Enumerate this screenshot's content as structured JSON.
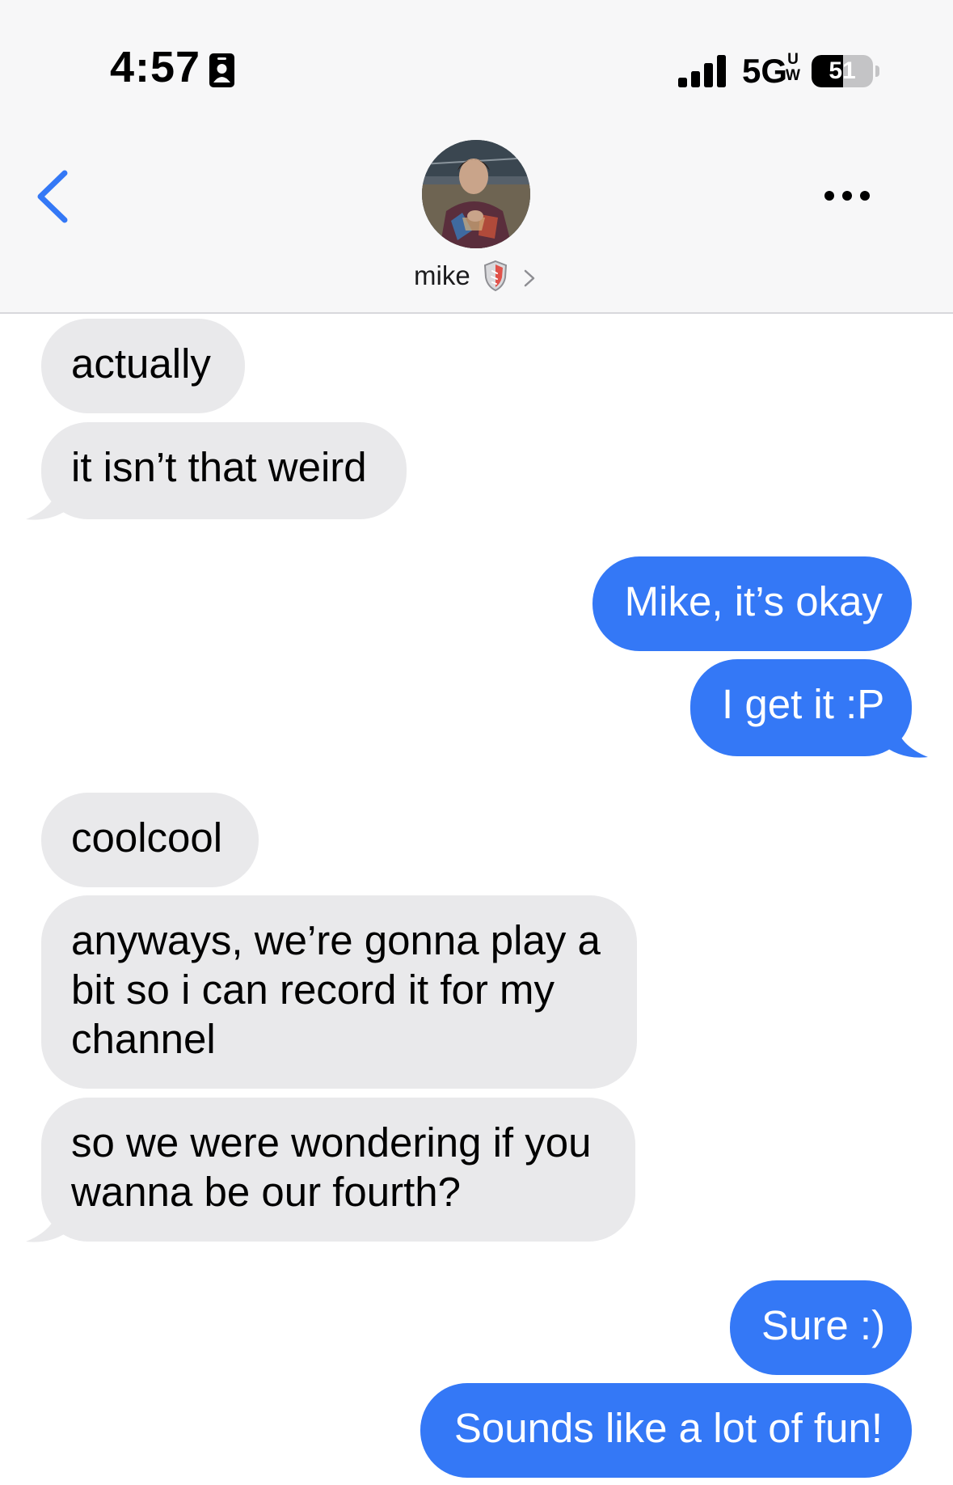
{
  "status_bar": {
    "time": "4:57",
    "network": "5G",
    "network_sup": "UW",
    "battery": "51",
    "battery_level_percent": 51
  },
  "nav": {
    "contact_name": "mike",
    "back_icon": "chevron-left-icon",
    "more_icon": "ellipsis-icon",
    "accent_color": "#3478f6"
  },
  "messages": [
    {
      "from": "them",
      "lines": [
        "actually"
      ]
    },
    {
      "from": "them",
      "lines": [
        "it isn’t that weird"
      ]
    },
    {
      "from": "me",
      "lines": [
        "Mike, it’s okay"
      ]
    },
    {
      "from": "me",
      "lines": [
        "I get it :P"
      ]
    },
    {
      "from": "them",
      "lines": [
        "coolcool"
      ]
    },
    {
      "from": "them",
      "lines": [
        "anyways, we’re gonna play a",
        "bit so i can record it for my",
        "channel"
      ]
    },
    {
      "from": "them",
      "lines": [
        "so we were wondering if you",
        "wanna be our fourth?"
      ]
    },
    {
      "from": "me",
      "lines": [
        "Sure :)"
      ]
    },
    {
      "from": "me",
      "lines": [
        "Sounds like a lot of fun!"
      ]
    }
  ],
  "colors": {
    "sent_bubble": "#3478f6",
    "received_bubble": "#e9e9eb",
    "header_background": "#f7f7f8"
  }
}
